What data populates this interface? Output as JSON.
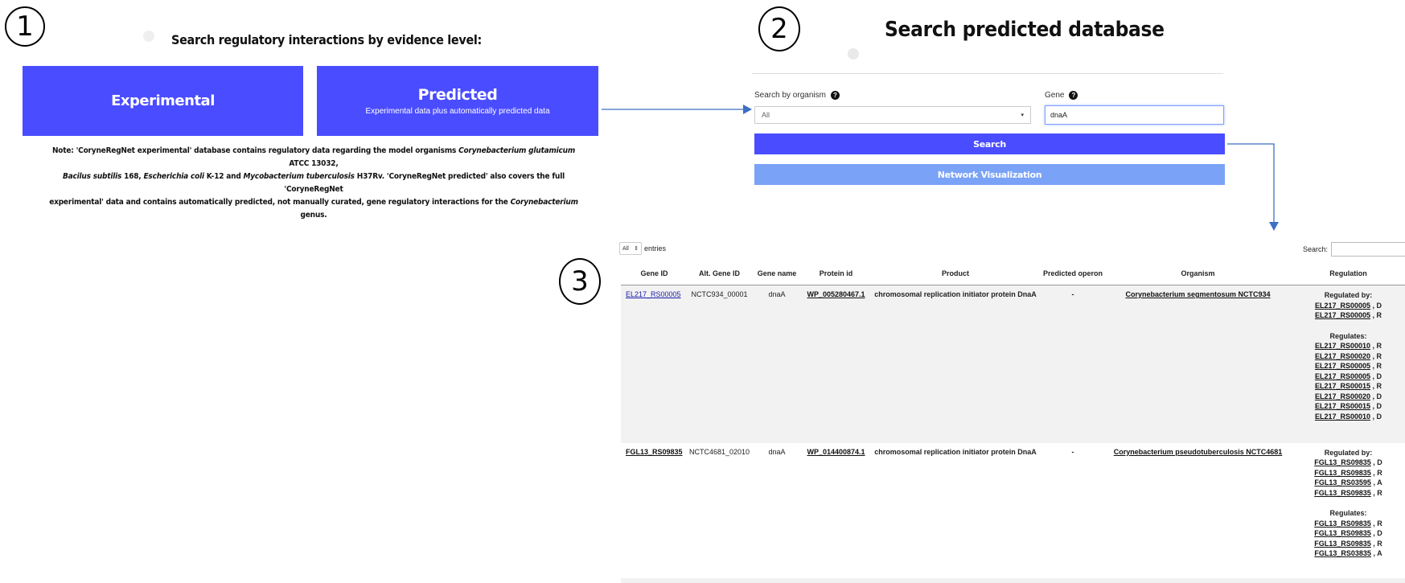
{
  "steps": [
    "1",
    "2",
    "3"
  ],
  "panel1": {
    "heading": "Search regulatory interactions by evidence level:",
    "experimental": {
      "title": "Experimental"
    },
    "predicted": {
      "title": "Predicted",
      "subtitle": "Experimental data plus automatically predicted data"
    },
    "note": {
      "l1a": "Note: 'CoryneRegNet experimental' database contains regulatory data regarding the model organisms ",
      "l1b": "Corynebacterium glutamicum",
      "l1c": " ATCC 13032,",
      "l2a": "Bacilus subtilis",
      "l2b": " 168, ",
      "l2c": "Escherichia coli",
      "l2d": " K-12 and ",
      "l2e": "Mycobacterium tuberculosis",
      "l2f": " H37Rv. 'CoryneRegNet predicted' also covers the full 'CoryneRegNet",
      "l3a": "experimental' data and contains automatically predicted, not manually curated, gene regulatory interactions for the ",
      "l3b": "Corynebacterium",
      "l3c": " genus."
    },
    "colors": {
      "button": "#4a4cff"
    }
  },
  "panel2": {
    "title": "Search predicted database",
    "organism_label": "Search by organism",
    "organism_value": "All",
    "gene_label": "Gene",
    "gene_value": "dnaA",
    "search_button": "Search",
    "network_button": "Network Visualization",
    "help_icon": "?",
    "colors": {
      "search": "#4a4cff",
      "network": "#7aa3f7"
    }
  },
  "panel3": {
    "length_value": "All",
    "entries_label": "entries",
    "search_label": "Search:",
    "columns": [
      "Gene ID",
      "Alt. Gene ID",
      "Gene name",
      "Protein id",
      "Product",
      "Predicted operon",
      "Organism",
      "Regulation"
    ],
    "rows": [
      {
        "gene_id": "EL217_RS00005",
        "alt_id": "NCTC934_00001",
        "gene_name": "dnaA",
        "protein_id": "WP_005280467.1",
        "product": "chromosomal replication initiator protein DnaA",
        "operon": "-",
        "organism": "Corynebacterium segmentosum NCTC934",
        "regulated_by_label": "Regulated by:",
        "regulated_by": [
          {
            "gene": "EL217_RS00005",
            "type": " , D"
          },
          {
            "gene": "EL217_RS00005",
            "type": " , R"
          }
        ],
        "regulates_label": "Regulates:",
        "regulates": [
          {
            "gene": "EL217_RS00010",
            "type": " , R"
          },
          {
            "gene": "EL217_RS00020",
            "type": " , R"
          },
          {
            "gene": "EL217_RS00005",
            "type": " , R"
          },
          {
            "gene": "EL217_RS00005",
            "type": " , D"
          },
          {
            "gene": "EL217_RS00015",
            "type": " , R"
          },
          {
            "gene": "EL217_RS00020",
            "type": " , D"
          },
          {
            "gene": "EL217_RS00015",
            "type": " , D"
          },
          {
            "gene": "EL217_RS00010",
            "type": " , D"
          }
        ]
      },
      {
        "gene_id": "FGL13_RS09835",
        "alt_id": "NCTC4681_02010",
        "gene_name": "dnaA",
        "protein_id": "WP_014400874.1",
        "product": "chromosomal replication initiator protein DnaA",
        "operon": "-",
        "organism": "Corynebacterium pseudotuberculosis NCTC4681",
        "regulated_by_label": "Regulated by:",
        "regulated_by": [
          {
            "gene": "FGL13_RS09835",
            "type": " , D"
          },
          {
            "gene": "FGL13_RS09835",
            "type": " , R"
          },
          {
            "gene": "FGL13_RS03595",
            "type": " , A"
          },
          {
            "gene": "FGL13_RS09835",
            "type": " , R"
          }
        ],
        "regulates_label": "Regulates:",
        "regulates": [
          {
            "gene": "FGL13_RS09835",
            "type": " , R"
          },
          {
            "gene": "FGL13_RS09835",
            "type": " , D"
          },
          {
            "gene": "FGL13_RS09835",
            "type": " , R"
          },
          {
            "gene": "FGL13_RS03835",
            "type": " , A"
          }
        ]
      }
    ]
  },
  "arrows": {
    "color": "#3d6fc4"
  }
}
